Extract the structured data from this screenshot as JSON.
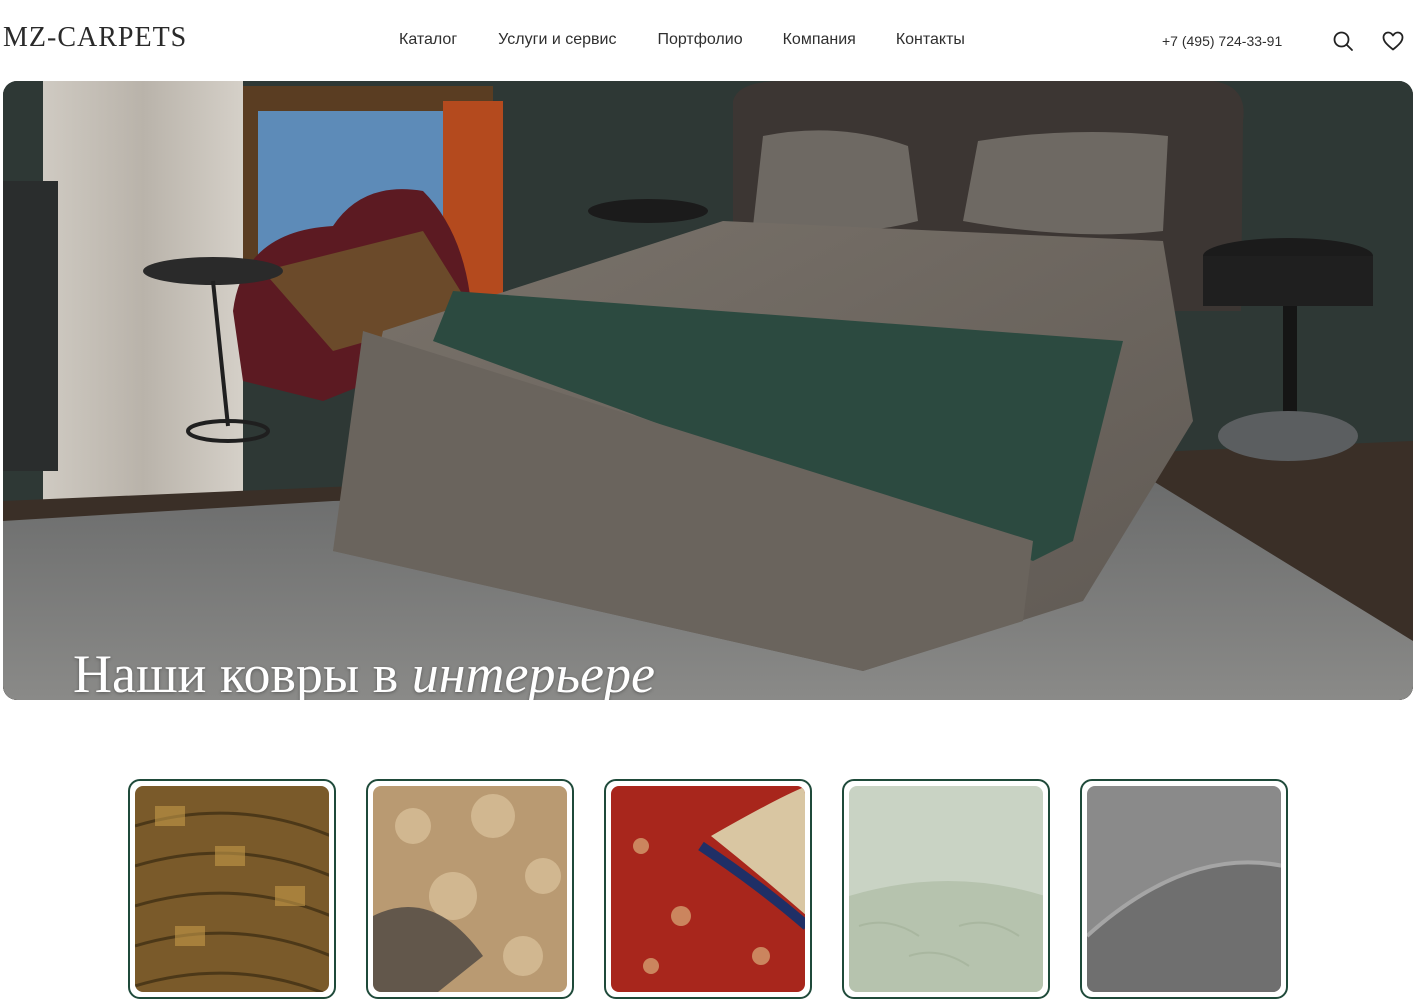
{
  "logo": "MZ-CARPETS",
  "nav": [
    "Каталог",
    "Услуги и сервис",
    "Портфолио",
    "Компания",
    "Контакты"
  ],
  "phone": "+7 (495) 724-33-91",
  "icons": {
    "search": "search-icon",
    "favorites": "heart-icon"
  },
  "hero": {
    "title_regular": "Наши ковры в",
    "title_italic": "интерьере",
    "slides_total": 5,
    "active_slide": 2
  },
  "categories": [
    {
      "icon": "carpet-classic-gold"
    },
    {
      "icon": "carpet-carved-beige"
    },
    {
      "icon": "carpet-red-persian"
    },
    {
      "icon": "carpet-mint-textured"
    },
    {
      "icon": "carpet-grey-plush"
    }
  ],
  "colors": {
    "accent": "#1f4a3a",
    "text": "#2f2f2f",
    "background": "#ffffff"
  }
}
